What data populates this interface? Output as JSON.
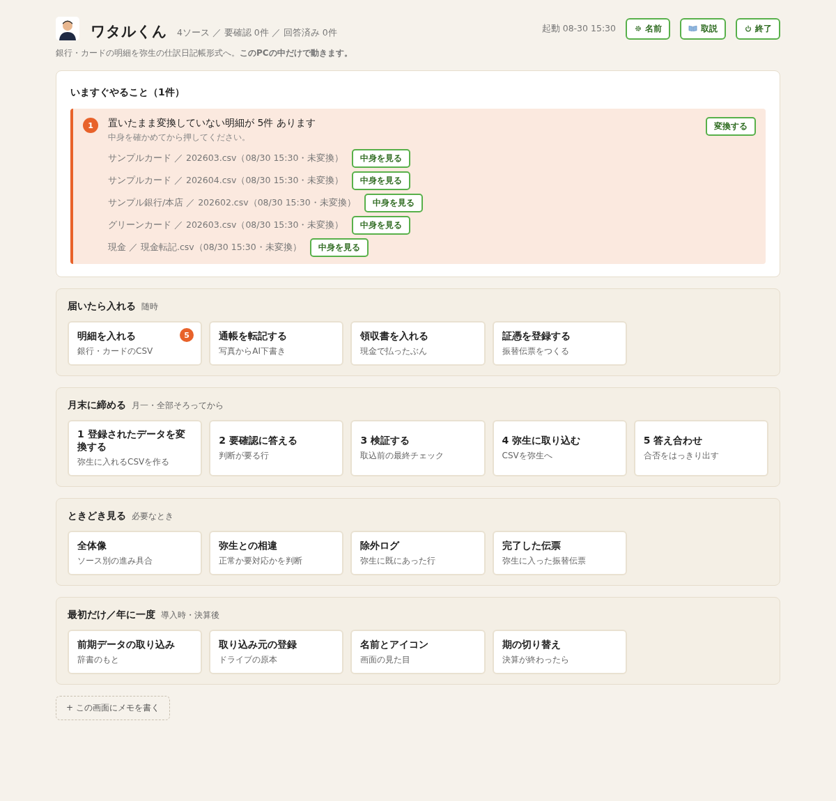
{
  "header": {
    "title": "ワタルくん",
    "stats": "4ソース ／ 要確認 0件 ／ 回答済み 0件",
    "started": "起動 08-30 15:30",
    "buttons": [
      {
        "kind": "gear",
        "label": "名前"
      },
      {
        "kind": "book",
        "label": "取説"
      },
      {
        "kind": "power",
        "label": "終了"
      }
    ],
    "subtitle": "銀行・カードの明細を弥生の仕訳日記帳形式へ。**このPCの中だけで動きます。**"
  },
  "todo": {
    "title": "いますぐやること（1件）",
    "alerts": [
      {
        "number": "1",
        "title": "置いたまま変換していない明細が 5件 あります",
        "hint": "中身を確かめてから押してください。",
        "action": "変換する",
        "files": [
          {
            "text": "サンプルカード ／ 202603.csv（08/30 15:30・未変換）",
            "button": "中身を見る"
          },
          {
            "text": "サンプルカード ／ 202604.csv（08/30 15:30・未変換）",
            "button": "中身を見る"
          },
          {
            "text": "サンプル銀行/本店 ／ 202602.csv（08/30 15:30・未変換）",
            "button": "中身を見る"
          },
          {
            "text": "グリーンカード ／ 202603.csv（08/30 15:30・未変換）",
            "button": "中身を見る"
          },
          {
            "text": "現金 ／ 現金転記.csv（08/30 15:30・未変換）",
            "button": "中身を見る"
          }
        ]
      }
    ]
  },
  "sections": [
    {
      "title": "届いたら入れる",
      "note": "随時",
      "cards": [
        {
          "title": "明細を入れる",
          "sub": "銀行・カードのCSV",
          "badge": "5"
        },
        {
          "title": "通帳を転記する",
          "sub": "写真からAI下書き"
        },
        {
          "title": "領収書を入れる",
          "sub": "現金で払ったぶん"
        },
        {
          "title": "証憑を登録する",
          "sub": "振替伝票をつくる"
        }
      ]
    },
    {
      "title": "月末に締める",
      "note": "月一・全部そろってから",
      "cards": [
        {
          "title": "1 登録されたデータを変換する",
          "sub": "弥生に入れるCSVを作る"
        },
        {
          "title": "2 要確認に答える",
          "sub": "判断が要る行"
        },
        {
          "title": "3 検証する",
          "sub": "取込前の最終チェック"
        },
        {
          "title": "4 弥生に取り込む",
          "sub": "CSVを弥生へ"
        },
        {
          "title": "5 答え合わせ",
          "sub": "合否をはっきり出す"
        }
      ]
    },
    {
      "title": "ときどき見る",
      "note": "必要なとき",
      "cards": [
        {
          "title": "全体像",
          "sub": "ソース別の進み具合"
        },
        {
          "title": "弥生との相違",
          "sub": "正常か要対応かを判断"
        },
        {
          "title": "除外ログ",
          "sub": "弥生に既にあった行"
        },
        {
          "title": "完了した伝票",
          "sub": "弥生に入った振替伝票"
        }
      ]
    },
    {
      "title": "最初だけ／年に一度",
      "note": "導入時・決算後",
      "cards": [
        {
          "title": "前期データの取り込み",
          "sub": "辞書のもと"
        },
        {
          "title": "取り込み元の登録",
          "sub": "ドライブの原本"
        },
        {
          "title": "名前とアイコン",
          "sub": "画面の見た目"
        },
        {
          "title": "期の切り替え",
          "sub": "決算が終わったら"
        }
      ]
    }
  ],
  "memo": {
    "label": "+ この画面にメモを書く"
  }
}
